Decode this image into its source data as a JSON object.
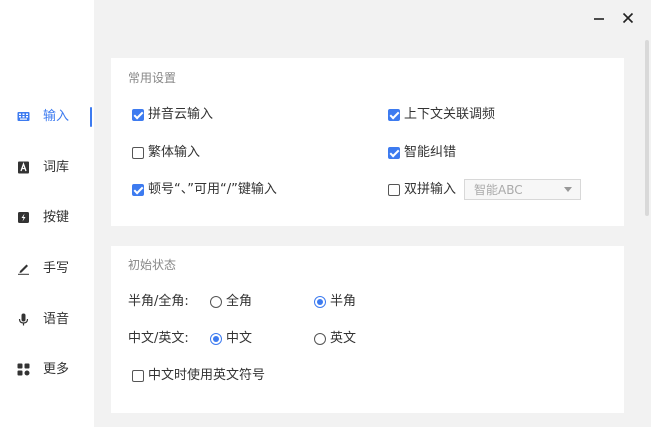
{
  "window": {
    "minimize_icon": "minimize-icon",
    "close_icon": "close-icon"
  },
  "sidebar": {
    "accent_color": "#3d7bf0",
    "items": [
      {
        "label": "输入",
        "icon": "keyboard-icon",
        "active": true
      },
      {
        "label": "词库",
        "icon": "dictionary-icon",
        "active": false
      },
      {
        "label": "按键",
        "icon": "key-icon",
        "active": false
      },
      {
        "label": "手写",
        "icon": "pen-icon",
        "active": false
      },
      {
        "label": "语音",
        "icon": "microphone-icon",
        "active": false
      },
      {
        "label": "更多",
        "icon": "grid-icon",
        "active": false
      }
    ]
  },
  "common_settings": {
    "title": "常用设置",
    "options": {
      "cloud_input": {
        "label": "拼音云输入",
        "checked": true
      },
      "context_freq": {
        "label": "上下文关联调频",
        "checked": true
      },
      "traditional": {
        "label": "繁体输入",
        "checked": false
      },
      "smart_correct": {
        "label": "智能纠错",
        "checked": true
      },
      "pause_mark": {
        "label": "顿号“、”可用“/”键输入",
        "checked": true
      },
      "double_pinyin": {
        "label": "双拼输入",
        "checked": false
      }
    },
    "double_pinyin_scheme": {
      "selected": "智能ABC"
    }
  },
  "initial_state": {
    "title": "初始状态",
    "width_row": {
      "label": "半角/全角:",
      "options": [
        {
          "label": "全角",
          "checked": false
        },
        {
          "label": "半角",
          "checked": true
        }
      ]
    },
    "lang_row": {
      "label": "中文/英文:",
      "options": [
        {
          "label": "中文",
          "checked": true
        },
        {
          "label": "英文",
          "checked": false
        }
      ]
    },
    "english_punct": {
      "label": "中文时使用英文符号",
      "checked": false
    }
  }
}
